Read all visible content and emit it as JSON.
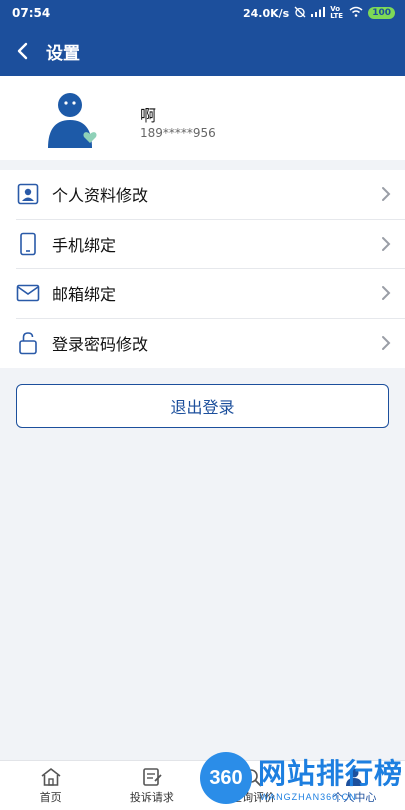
{
  "status_bar": {
    "time": "07:54",
    "network_speed": "24.0K/s",
    "volte": "Vo LTE",
    "battery": "100"
  },
  "header": {
    "title": "设置"
  },
  "profile": {
    "name": "啊",
    "phone": "189*****956"
  },
  "menu": {
    "items": [
      {
        "label": "个人资料修改",
        "icon": "profile-card-icon"
      },
      {
        "label": "手机绑定",
        "icon": "phone-icon"
      },
      {
        "label": "邮箱绑定",
        "icon": "mail-icon"
      },
      {
        "label": "登录密码修改",
        "icon": "lock-icon"
      }
    ]
  },
  "logout": {
    "label": "退出登录"
  },
  "tabbar": {
    "tabs": [
      {
        "label": "首页",
        "icon": "home-icon"
      },
      {
        "label": "投诉请求",
        "icon": "complaint-icon"
      },
      {
        "label": "查询评价",
        "icon": "query-icon"
      },
      {
        "label": "个人中心",
        "icon": "user-icon"
      }
    ]
  },
  "watermark": {
    "logo": "360",
    "text": "网站排行榜",
    "sub": "WANGZHAN360.CN"
  },
  "colors": {
    "brand": "#1c4f9c",
    "background": "#f1f3f7"
  }
}
